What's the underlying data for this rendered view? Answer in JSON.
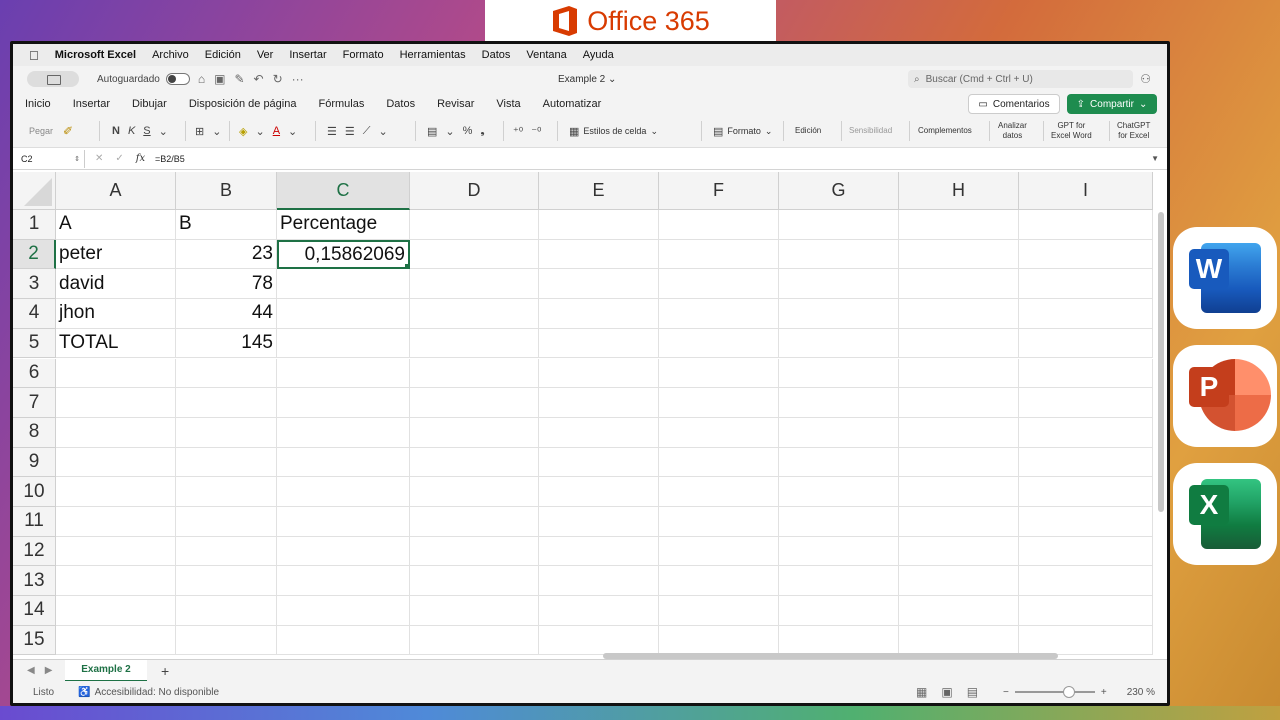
{
  "banner": {
    "text": "Office 365"
  },
  "menubar": {
    "app_name": "Microsoft Excel",
    "items": [
      "Archivo",
      "Edición",
      "Ver",
      "Insertar",
      "Formato",
      "Herramientas",
      "Datos",
      "Ventana",
      "Ayuda"
    ]
  },
  "titlebar": {
    "autosave_label": "Autoguardado",
    "doc_title": "Example 2",
    "search_placeholder": "Buscar (Cmd + Ctrl + U)"
  },
  "ribbon_tabs": {
    "tabs": [
      "Inicio",
      "Insertar",
      "Dibujar",
      "Disposición de página",
      "Fórmulas",
      "Datos",
      "Revisar",
      "Vista",
      "Automatizar"
    ],
    "comments_label": "Comentarios",
    "share_label": "Compartir"
  },
  "ribbon": {
    "paste_label": "Pegar",
    "bold": "N",
    "italic": "K",
    "underline": "S",
    "percent": "%",
    "cell_styles_label": "Estilos de celda",
    "format_label": "Formato",
    "edition_label": "Edición",
    "sensitivity_label": "Sensibilidad",
    "addins_label": "Complementos",
    "analyze_label_1": "Analizar",
    "analyze_label_2": "datos",
    "gpt_word_1": "GPT for",
    "gpt_word_2": "Excel Word",
    "chatgpt_1": "ChatGPT",
    "chatgpt_2": "for Excel"
  },
  "formula_bar": {
    "name_box": "C2",
    "fx": "fx",
    "formula": "=B2/B5"
  },
  "sheet": {
    "columns": [
      "A",
      "B",
      "C",
      "D",
      "E",
      "F",
      "G",
      "H",
      "I"
    ],
    "rows": [
      "1",
      "2",
      "3",
      "4",
      "5",
      "6",
      "7",
      "8",
      "9",
      "10",
      "11",
      "12",
      "13",
      "14",
      "15"
    ],
    "cells": {
      "A1": "A",
      "B1": "B",
      "C1": "Percentage",
      "A2": "peter",
      "B2": "23",
      "C2": "0,15862069",
      "A3": "david",
      "B3": "78",
      "A4": "jhon",
      "B4": "44",
      "A5": "TOTAL",
      "B5": "145"
    },
    "active_cell": "C2"
  },
  "sheet_tabs": {
    "active": "Example 2",
    "add": "+"
  },
  "status": {
    "ready": "Listo",
    "accessibility": "Accesibilidad: No disponible",
    "zoom": "230 %"
  },
  "dock_apps": [
    "Word",
    "PowerPoint",
    "Excel"
  ],
  "colors": {
    "excel_green": "#1e7145",
    "share_green": "#1e8c4f",
    "office_orange": "#d83b01"
  }
}
